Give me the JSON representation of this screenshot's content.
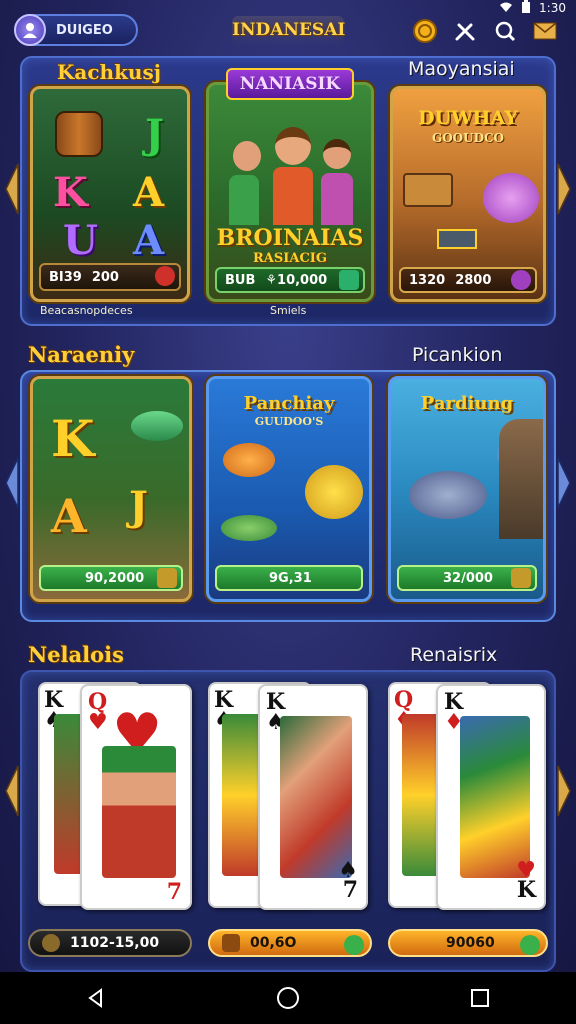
{
  "status_bar": {
    "time": "1:30"
  },
  "header": {
    "profile_name": "DUIGEO",
    "app_title": "INDANESAI"
  },
  "icons": [
    "user-icon",
    "coin-icon",
    "tools-icon",
    "search-icon",
    "mail-icon",
    "wifi-icon",
    "battery-icon"
  ],
  "sections": [
    {
      "label_left": "",
      "label_right": "Maoyansiai",
      "cards": [
        {
          "title": "Kachkusj",
          "bar_left": "BI39",
          "bar_value": "200",
          "caption": "Beacasnopdeces"
        },
        {
          "title": "NANIASIK",
          "subtitle": "BROINAIAS",
          "subtitle2": "RASIACIG",
          "bar_left": "BUB",
          "bar_value": "⚘10,000",
          "caption": "Smiels"
        },
        {
          "title": "DUWHAY",
          "subtitle": "GOOUDCO",
          "bar_left": "1320",
          "bar_value": "2800"
        }
      ]
    },
    {
      "label_left": "Naraeniy",
      "label_right": "Picankion",
      "cards": [
        {
          "bar_value": "90,2000"
        },
        {
          "title": "Panchiay",
          "subtitle": "GUUDOO'S",
          "bar_value": "9G,31"
        },
        {
          "title": "Pardiung",
          "bar_value": "32/000"
        }
      ]
    },
    {
      "label_left": "Nelalois",
      "label_right": "Renaisrix",
      "pills": [
        {
          "value": "1102-15,00"
        },
        {
          "value": "00,6O"
        },
        {
          "value": "90060"
        }
      ]
    }
  ],
  "cards_letters": {
    "k": "K",
    "a": "A",
    "u": "U",
    "q": "Q",
    "seven": "7"
  },
  "nav": [
    "back-icon",
    "home-icon",
    "recents-icon"
  ],
  "colors": {
    "gold": "#ffcf3a",
    "panel": "#2c3a8c",
    "green": "#3bb14a",
    "orange": "#f0a020"
  }
}
